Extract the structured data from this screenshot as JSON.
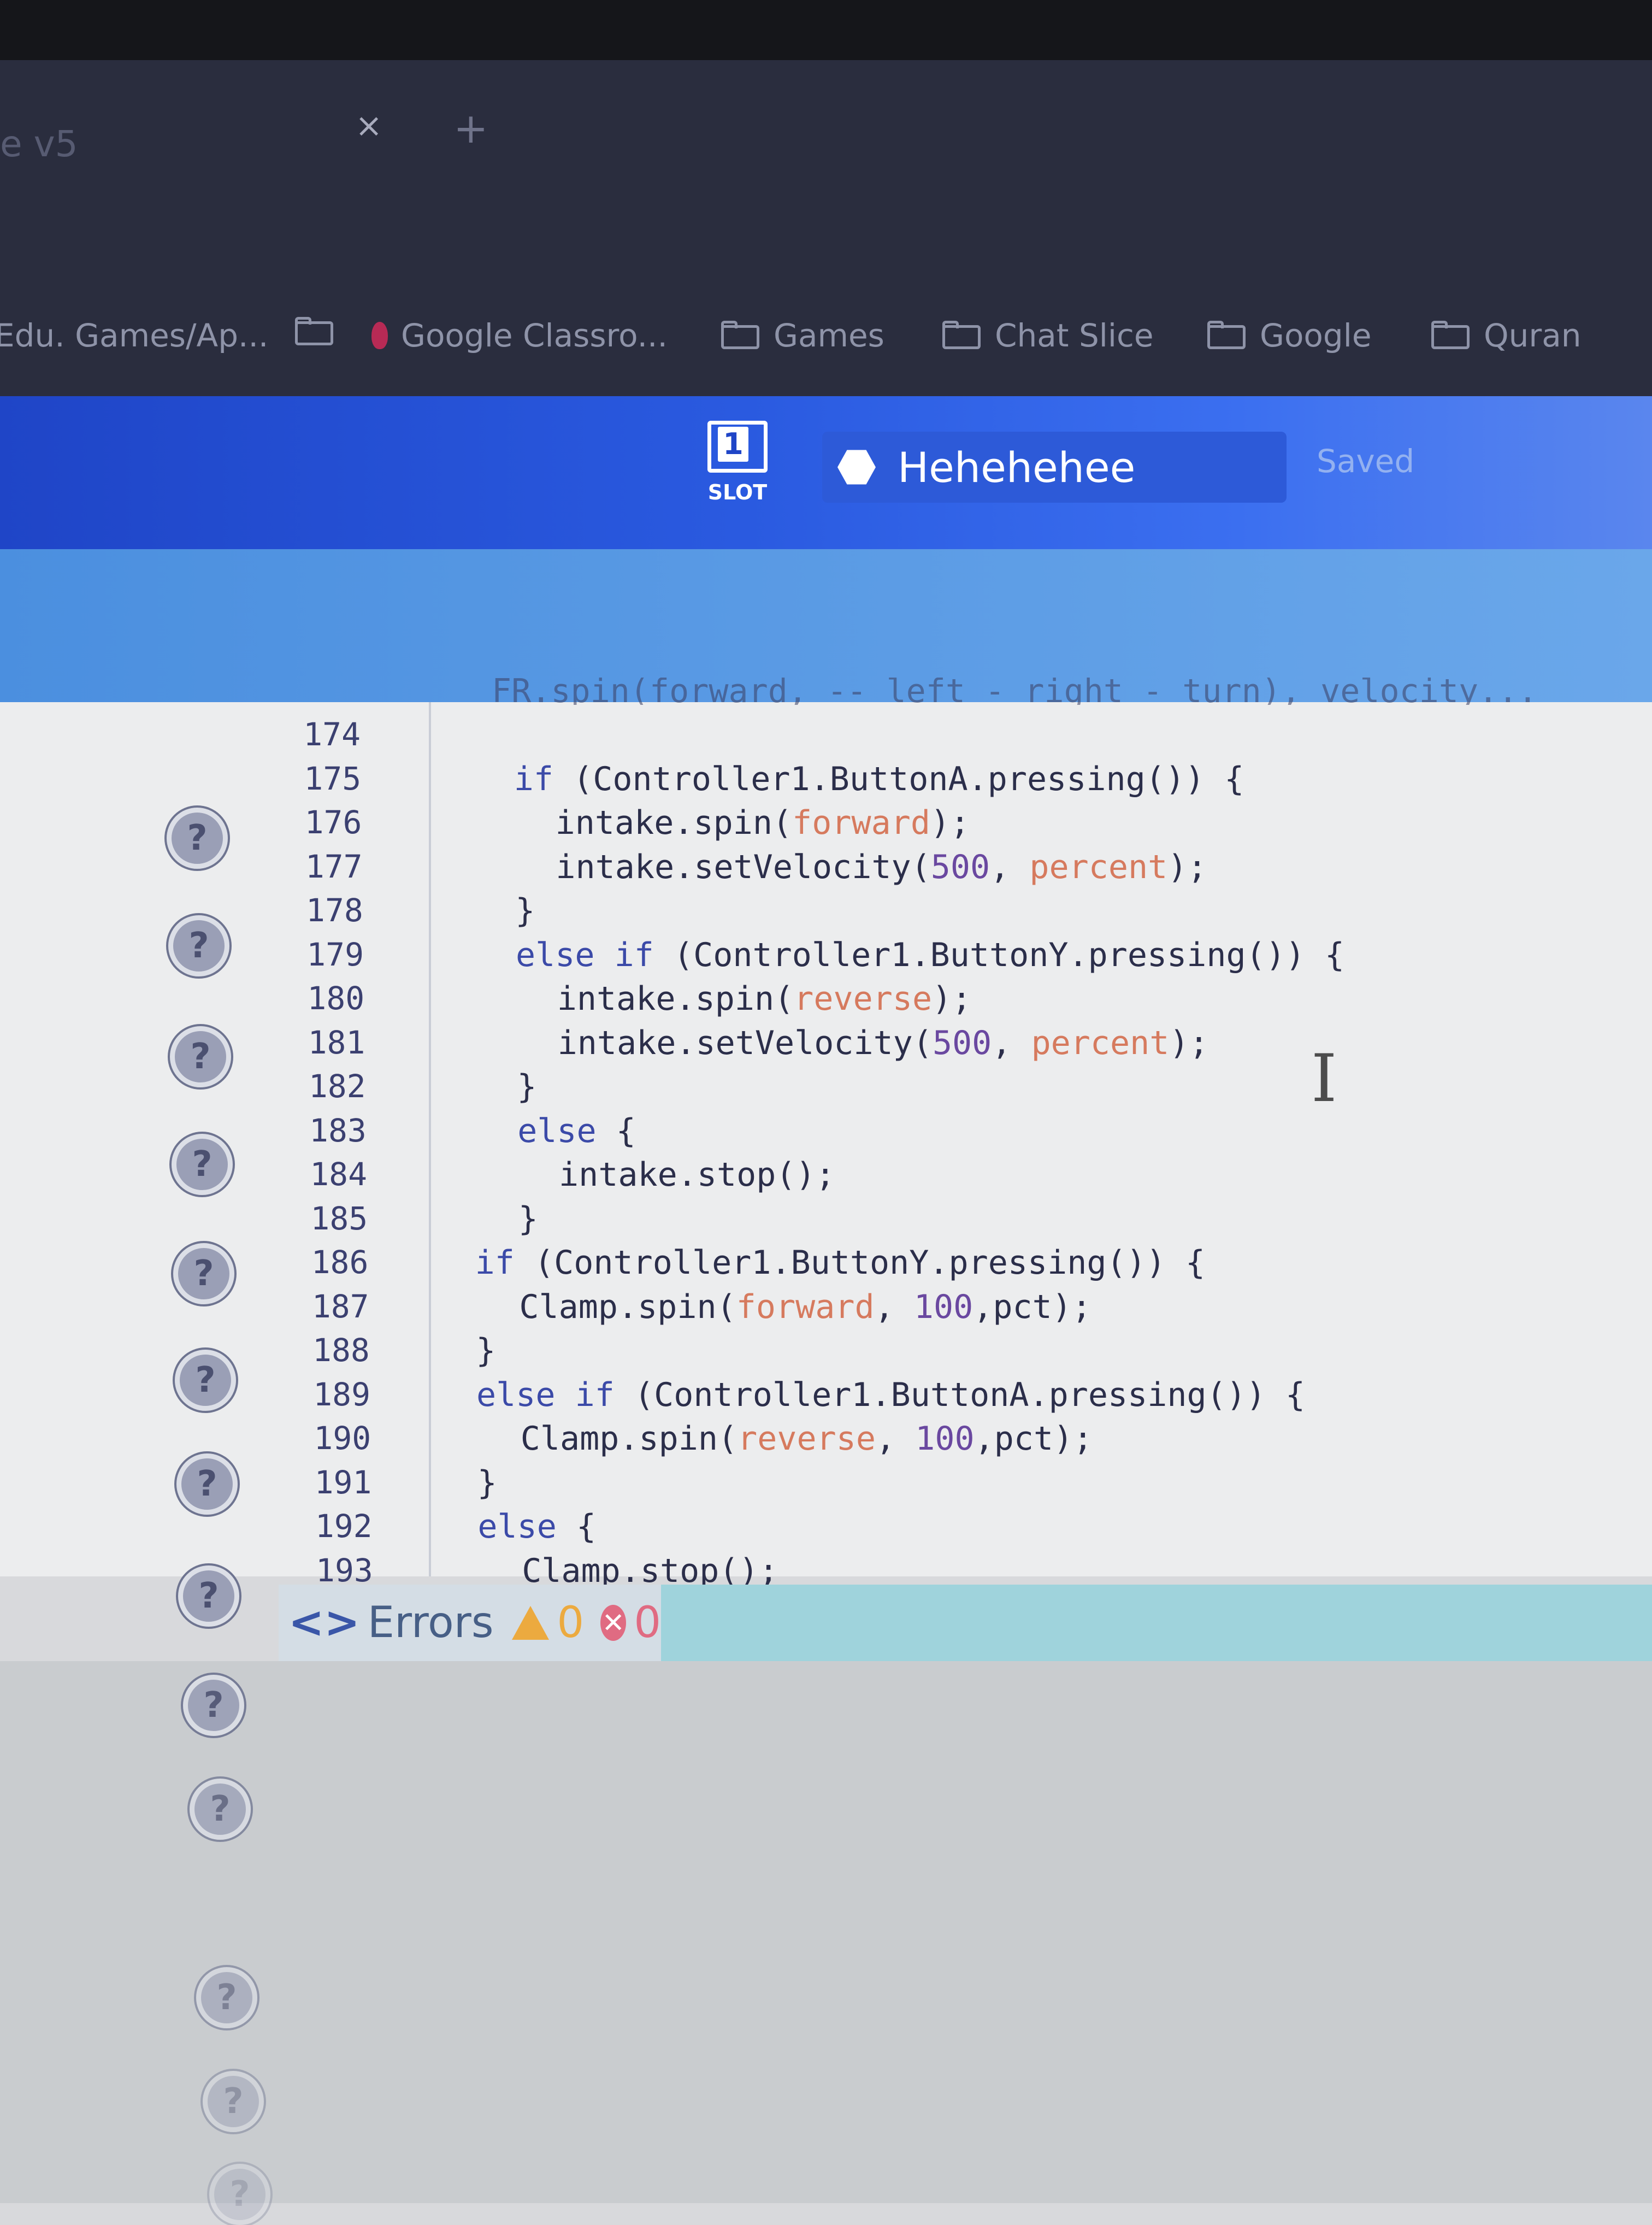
{
  "browser": {
    "tab_fragment": "e v5",
    "tab_close": "×",
    "tab_new": "+",
    "bookmarks": [
      {
        "label": "Edu. Games/Ap...",
        "icon": "none"
      },
      {
        "label": "",
        "icon": "folder-icon"
      },
      {
        "label": "Google Classro...",
        "icon": "tulip-icon"
      },
      {
        "label": "Games",
        "icon": "folder-icon"
      },
      {
        "label": "Chat Slice",
        "icon": "folder-icon"
      },
      {
        "label": "Google",
        "icon": "folder-icon"
      },
      {
        "label": "Quran",
        "icon": "folder-icon"
      }
    ]
  },
  "app": {
    "slot_number": "1",
    "slot_label": "SLOT",
    "project_name": "Hehehehee",
    "save_status": "Saved",
    "accent": "#2a5ae0"
  },
  "editor": {
    "cut_line": "FR.spin(forward, -- left - right - turn), velocity...",
    "lines": [
      {
        "n": "174",
        "indent": 0,
        "html": ""
      },
      {
        "n": "175",
        "indent": 2,
        "html": "<span class='kw'>if</span> (Controller1.ButtonA.pressing()) {"
      },
      {
        "n": "176",
        "indent": 3,
        "html": "intake.spin(<span class='str'>forward</span>);"
      },
      {
        "n": "177",
        "indent": 3,
        "html": "intake.setVelocity(<span class='num'>500</span>, <span class='str'>percent</span>);"
      },
      {
        "n": "178",
        "indent": 2,
        "html": "}"
      },
      {
        "n": "179",
        "indent": 2,
        "html": "<span class='kw'>else if</span> (Controller1.ButtonY.pressing()) {"
      },
      {
        "n": "180",
        "indent": 3,
        "html": "intake.spin(<span class='str'>reverse</span>);"
      },
      {
        "n": "181",
        "indent": 3,
        "html": "intake.setVelocity(<span class='num'>500</span>, <span class='str'>percent</span>);"
      },
      {
        "n": "182",
        "indent": 2,
        "html": "}"
      },
      {
        "n": "183",
        "indent": 2,
        "html": "<span class='kw'>else</span> {"
      },
      {
        "n": "184",
        "indent": 3,
        "html": "intake.stop();"
      },
      {
        "n": "185",
        "indent": 2,
        "html": "}"
      },
      {
        "n": "186",
        "indent": 1,
        "html": "<span class='kw'>if</span> (Controller1.ButtonY.pressing()) {"
      },
      {
        "n": "187",
        "indent": 2,
        "html": "Clamp.spin(<span class='str'>forward</span>, <span class='num'>100</span>,pct);"
      },
      {
        "n": "188",
        "indent": 1,
        "html": "}"
      },
      {
        "n": "189",
        "indent": 1,
        "html": "<span class='kw'>else if</span> (Controller1.ButtonA.pressing()) {"
      },
      {
        "n": "190",
        "indent": 2,
        "html": "Clamp.spin(<span class='str'>reverse</span>, <span class='num'>100</span>,pct);"
      },
      {
        "n": "191",
        "indent": 1,
        "html": "}"
      },
      {
        "n": "192",
        "indent": 1,
        "html": "<span class='kw'>else</span> {"
      },
      {
        "n": "193",
        "indent": 2,
        "html": "Clamp.stop();"
      }
    ],
    "help_icon_symbol": "?",
    "help_icon_count": 14
  },
  "errors": {
    "chevrons": "<>",
    "label": "Errors",
    "warning_count": "0",
    "error_count": "0",
    "error_symbol": "✕"
  }
}
